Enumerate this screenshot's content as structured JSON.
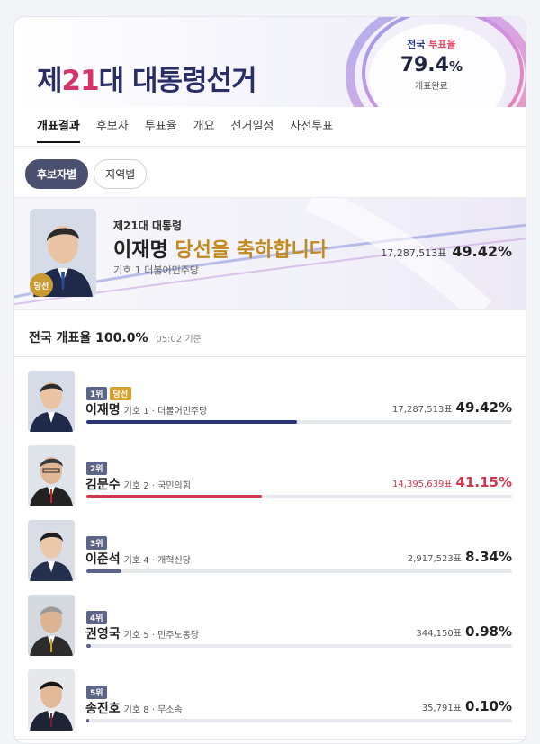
{
  "header": {
    "title_prefix": "제",
    "title_number": "21",
    "title_suffix": "대 대통령선거",
    "turnout_label_a": "전국",
    "turnout_label_b": "투표율",
    "turnout_value": "79.4",
    "turnout_unit": "%",
    "turnout_sub": "개표완료"
  },
  "tabs": [
    "개표결과",
    "후보자",
    "투표율",
    "개요",
    "선거일정",
    "사전투표"
  ],
  "filters": [
    "후보자별",
    "지역별"
  ],
  "winner": {
    "badge": "당선",
    "election": "제21대 대통령",
    "name": "이재명",
    "congrats": "당선을 축하합니다",
    "meta": "기호 1 더불어민주당",
    "votes": "17,287,513표",
    "pct": "49.42%"
  },
  "count": {
    "label": "전국 개표율",
    "pct": "100.0%",
    "time": "05:02 기준"
  },
  "candidates": [
    {
      "rank": "1위",
      "elected": "당선",
      "name": "이재명",
      "meta": "기호 1 · 더불어민주당",
      "votes": "17,287,513표",
      "pct": "49.42%",
      "share": 49.42,
      "color": "#2a3478"
    },
    {
      "rank": "2위",
      "elected": "",
      "name": "김문수",
      "meta": "기호 2 · 국민의힘",
      "votes": "14,395,639표",
      "pct": "41.15%",
      "share": 41.15,
      "color": "#d0374b"
    },
    {
      "rank": "3위",
      "elected": "",
      "name": "이준석",
      "meta": "기호 4 · 개혁신당",
      "votes": "2,917,523표",
      "pct": "8.34%",
      "share": 8.34,
      "color": "#5c6488"
    },
    {
      "rank": "4위",
      "elected": "",
      "name": "권영국",
      "meta": "기호 5 · 민주노동당",
      "votes": "344,150표",
      "pct": "0.98%",
      "share": 0.98,
      "color": "#5c6488"
    },
    {
      "rank": "5위",
      "elected": "",
      "name": "송진호",
      "meta": "기호 8 · 무소속",
      "votes": "35,791표",
      "pct": "0.10%",
      "share": 0.1,
      "color": "#5c6488"
    }
  ]
}
